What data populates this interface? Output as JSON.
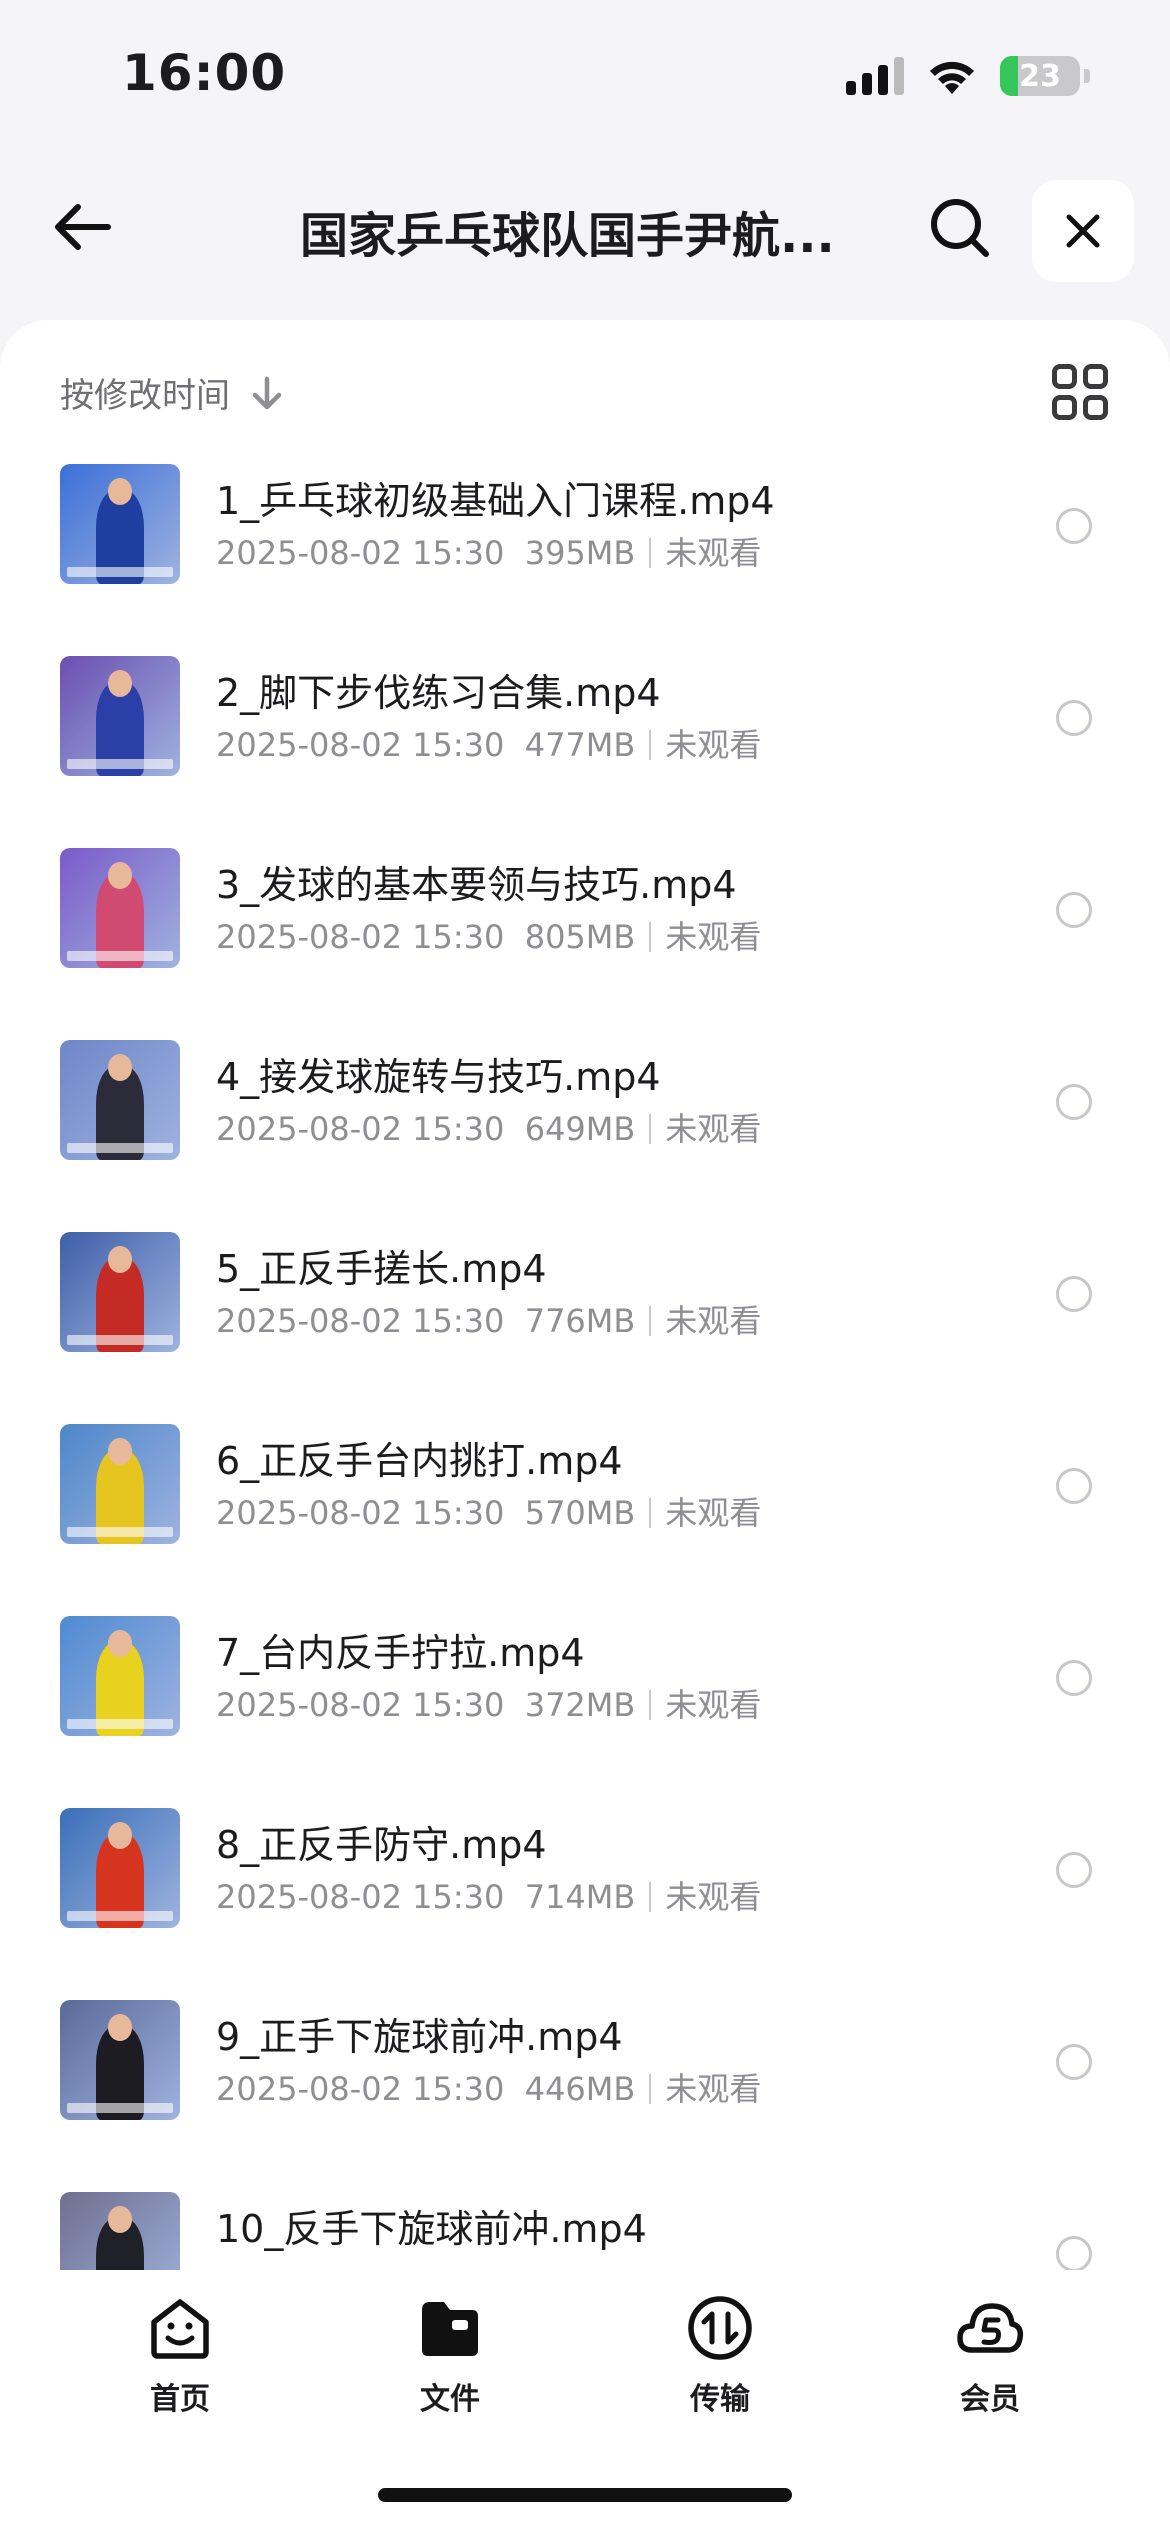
{
  "status_bar": {
    "time": "16:00",
    "battery": "23",
    "battery_percent": 23,
    "icons": [
      "signal-icon",
      "wifi-icon",
      "battery-charging-icon"
    ]
  },
  "nav": {
    "title": "国家乒乓球队国手尹航...",
    "icons": [
      "back-arrow-icon",
      "search-icon",
      "close-icon"
    ]
  },
  "sort": {
    "label": "按修改时间",
    "direction_icon": "arrow-down-icon",
    "view_icon": "grid-view-icon"
  },
  "files": [
    {
      "name": "1_乒乓球初级基础入门课程.mp4",
      "date": "2025-08-02 15:30",
      "size": "395MB",
      "status": "未观看",
      "thumb_bg": "#3b6fd8",
      "thumb_fg": "#1f3fa0"
    },
    {
      "name": "2_脚下步伐练习合集.mp4",
      "date": "2025-08-02 15:30",
      "size": "477MB",
      "status": "未观看",
      "thumb_bg": "#6a4fb0",
      "thumb_fg": "#2a3fa8"
    },
    {
      "name": "3_发球的基本要领与技巧.mp4",
      "date": "2025-08-02 15:30",
      "size": "805MB",
      "status": "未观看",
      "thumb_bg": "#7b5ac9",
      "thumb_fg": "#d04a72"
    },
    {
      "name": "4_接发球旋转与技巧.mp4",
      "date": "2025-08-02 15:30",
      "size": "649MB",
      "status": "未观看",
      "thumb_bg": "#6f86c8",
      "thumb_fg": "#2b2b3a"
    },
    {
      "name": "5_正反手搓长.mp4",
      "date": "2025-08-02 15:30",
      "size": "776MB",
      "status": "未观看",
      "thumb_bg": "#3e5fa8",
      "thumb_fg": "#c42b24"
    },
    {
      "name": "6_正反手台内挑打.mp4",
      "date": "2025-08-02 15:30",
      "size": "570MB",
      "status": "未观看",
      "thumb_bg": "#4d87c9",
      "thumb_fg": "#e6c521"
    },
    {
      "name": "7_台内反手拧拉.mp4",
      "date": "2025-08-02 15:30",
      "size": "372MB",
      "status": "未观看",
      "thumb_bg": "#4f8ad2",
      "thumb_fg": "#e9d21f"
    },
    {
      "name": "8_正反手防守.mp4",
      "date": "2025-08-02 15:30",
      "size": "714MB",
      "status": "未观看",
      "thumb_bg": "#3a6fb8",
      "thumb_fg": "#d7341f"
    },
    {
      "name": "9_正手下旋球前冲.mp4",
      "date": "2025-08-02 15:30",
      "size": "446MB",
      "status": "未观看",
      "thumb_bg": "#5a6a98",
      "thumb_fg": "#1c1c22"
    },
    {
      "name": "10_反手下旋球前冲.mp4",
      "date": "",
      "size": "",
      "status": "",
      "thumb_bg": "#6e6f8e",
      "thumb_fg": "#202028"
    }
  ],
  "tabs": [
    {
      "label": "首页",
      "icon": "home-smile-icon"
    },
    {
      "label": "文件",
      "icon": "folder-icon"
    },
    {
      "label": "传输",
      "icon": "transfer-icon"
    },
    {
      "label": "会员",
      "icon": "vip-cloud-icon"
    }
  ]
}
